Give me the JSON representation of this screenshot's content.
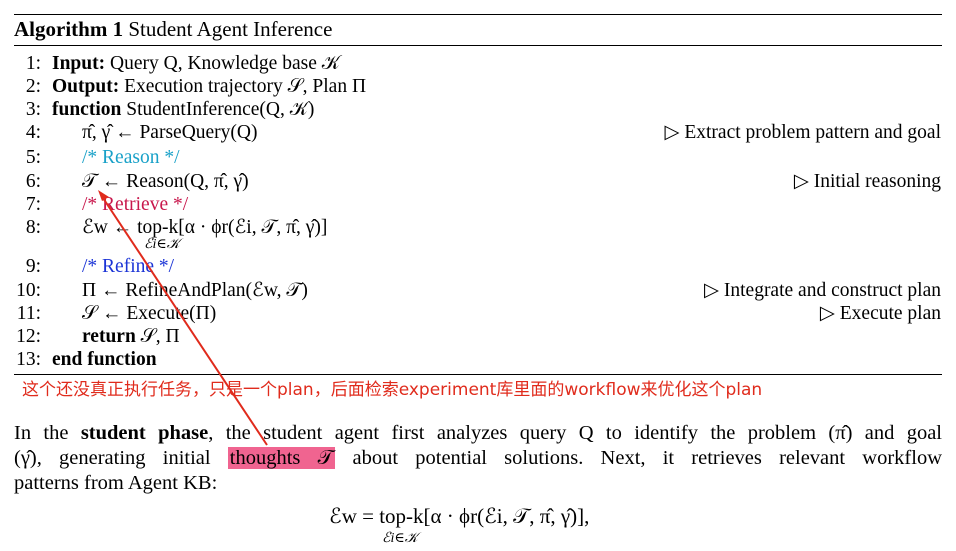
{
  "algorithm": {
    "title_prefix": "Algorithm 1",
    "title": "Student Agent Inference",
    "lines": [
      {
        "num": "1:",
        "parts": [
          "Input:",
          " Query Q, Knowledge base 𝒦"
        ]
      },
      {
        "num": "2:",
        "parts": [
          "Output:",
          " Execution trajectory 𝒮, Plan Π"
        ]
      },
      {
        "num": "3:",
        "parts": [
          "function",
          " StudentInference(Q, 𝒦)"
        ]
      },
      {
        "num": "4:",
        "code": "π̂, γ̂ ← ParseQuery(Q)",
        "comment": "▷ Extract problem pattern and goal"
      },
      {
        "num": "5:",
        "code": "/* Reason */"
      },
      {
        "num": "6:",
        "code": "𝒯 ← Reason(Q, π̂, γ̂)",
        "comment": "▷ Initial reasoning"
      },
      {
        "num": "7:",
        "code": "/* Retrieve */"
      },
      {
        "num": "8:",
        "code": "ℰw ← top-k[α · ϕr(ℰi, 𝒯, π̂, γ̂)]",
        "subscript": "ℰi∈𝒦"
      },
      {
        "num": "9:",
        "code": "/* Refine */"
      },
      {
        "num": "10:",
        "code": "Π ← RefineAndPlan(ℰw, 𝒯)",
        "comment": "▷ Integrate and construct plan"
      },
      {
        "num": "11:",
        "code": "𝒮 ← Execute(Π)",
        "comment": "▷ Execute plan"
      },
      {
        "num": "12:",
        "parts": [
          "return",
          " 𝒮, Π"
        ]
      },
      {
        "num": "13:",
        "code": "end function"
      }
    ]
  },
  "annotation": {
    "note": "这个还没真正执行任务，只是一个plan，后面检索experiment库里面的workflow来优化这个plan",
    "color": "#e02b1c",
    "highlight_color": "#f06490"
  },
  "paragraph": {
    "line1": {
      "pre": "In the ",
      "bold": "student phase",
      "post": ", the student agent first analyzes query Q to identify the problem (π̂) and goal"
    },
    "line2": {
      "pre": "(γ̂), generating initial ",
      "highlight": "thoughts 𝒯",
      "post": " about potential solutions.  Next, it retrieves relevant workflow"
    },
    "line3": "patterns from Agent KB:",
    "equation": "ℰw = top-k[α · ϕr(ℰi, 𝒯, π̂, γ̂)],",
    "equation_sub": "ℰi∈𝒦"
  }
}
